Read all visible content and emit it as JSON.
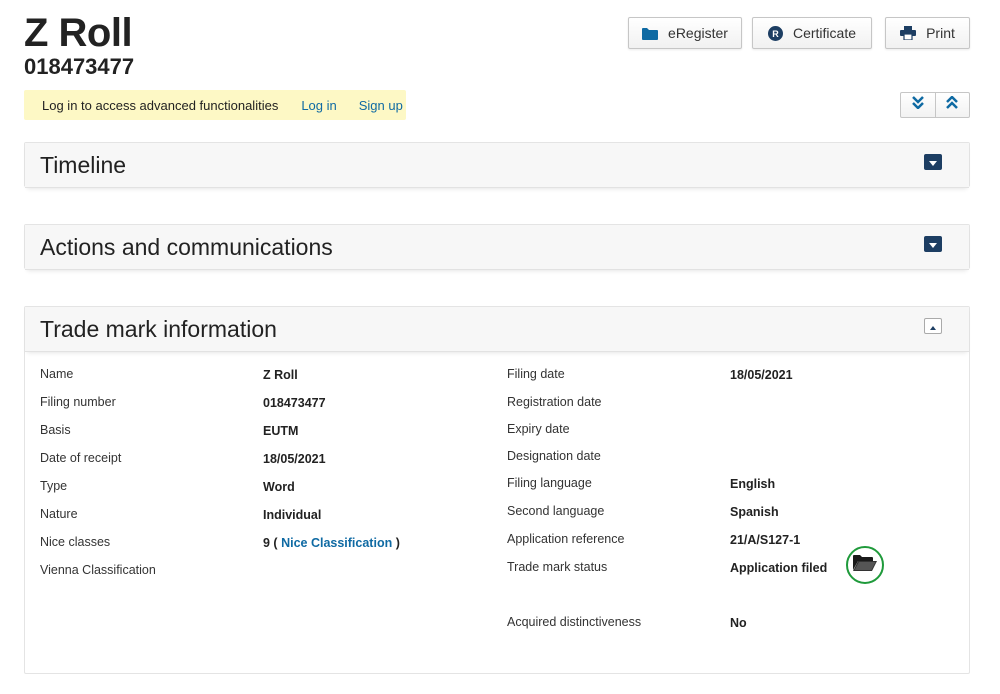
{
  "header": {
    "title": "Z Roll",
    "number": "018473477",
    "buttons": {
      "eregister": "eRegister",
      "certificate": "Certificate",
      "print": "Print"
    }
  },
  "login_bar": {
    "message": "Log in to access advanced functionalities",
    "login_label": "Log in",
    "signup_label": "Sign up"
  },
  "panels": {
    "timeline": "Timeline",
    "actions": "Actions and communications",
    "trade_mark_info": "Trade mark information"
  },
  "trade_mark_info": {
    "left": [
      {
        "label": "Name",
        "value": "Z Roll"
      },
      {
        "label": "Filing number",
        "value": "018473477"
      },
      {
        "label": "Basis",
        "value": "EUTM"
      },
      {
        "label": "Date of receipt",
        "value": "18/05/2021"
      },
      {
        "label": "Type",
        "value": "Word"
      },
      {
        "label": "Nature",
        "value": "Individual"
      },
      {
        "label": "Nice classes",
        "value_prefix": "9 ( ",
        "value_link": "Nice Classification",
        "value_suffix": " )"
      },
      {
        "label": "Vienna Classification",
        "value": ""
      }
    ],
    "right": [
      {
        "label": "Filing date",
        "value": "18/05/2021"
      },
      {
        "label": "Registration date",
        "value": ""
      },
      {
        "label": "Expiry date",
        "value": ""
      },
      {
        "label": "Designation date",
        "value": ""
      },
      {
        "label": "Filing language",
        "value": "English"
      },
      {
        "label": "Second language",
        "value": "Spanish"
      },
      {
        "label": "Application reference",
        "value": "21/A/S127-1"
      },
      {
        "label": "Trade mark status",
        "value": "Application filed"
      },
      {
        "label": "Acquired distinctiveness",
        "value": "No"
      }
    ]
  },
  "icons": {
    "eregister": "folder-icon",
    "certificate": "registered-icon",
    "print": "printer-icon",
    "status": "open-folder-icon"
  },
  "colors": {
    "link": "#0f6aa3",
    "login_bar_bg": "#fdf8c5",
    "toggle_dark": "#1d3e63",
    "status_ring": "#1f9a3b"
  }
}
